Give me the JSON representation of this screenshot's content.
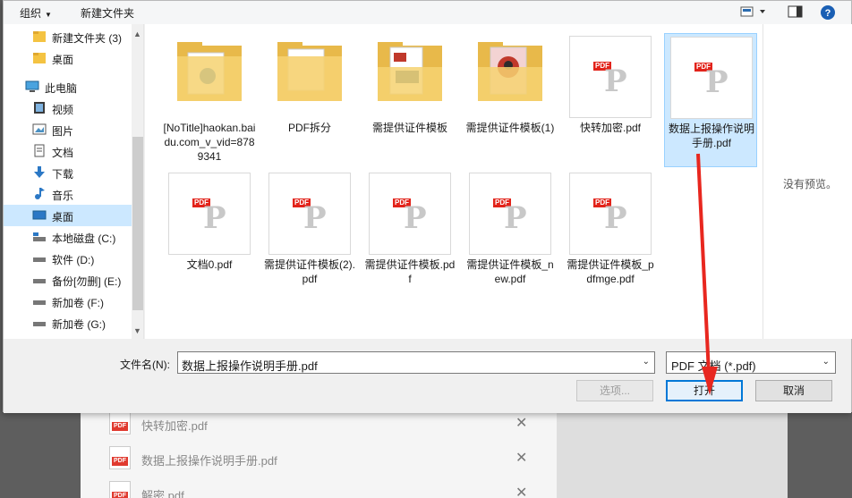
{
  "toolbar": {
    "organize_label": "组织",
    "new_folder_label": "新建文件夹"
  },
  "nav": {
    "items": [
      {
        "label": "新建文件夹 (3)",
        "icon": "folder-icon"
      },
      {
        "label": "桌面",
        "icon": "folder-icon"
      },
      {
        "label": "此电脑",
        "icon": "computer-icon"
      },
      {
        "label": "视频",
        "icon": "video-icon"
      },
      {
        "label": "图片",
        "icon": "picture-icon"
      },
      {
        "label": "文档",
        "icon": "document-icon"
      },
      {
        "label": "下载",
        "icon": "download-icon"
      },
      {
        "label": "音乐",
        "icon": "music-icon"
      },
      {
        "label": "桌面",
        "icon": "desktop-icon"
      },
      {
        "label": "本地磁盘 (C:)",
        "icon": "drive-icon"
      },
      {
        "label": "软件 (D:)",
        "icon": "drive-icon"
      },
      {
        "label": "备份[勿删] (E:)",
        "icon": "drive-icon"
      },
      {
        "label": "新加卷 (F:)",
        "icon": "drive-icon"
      },
      {
        "label": "新加卷 (G:)",
        "icon": "drive-icon"
      }
    ]
  },
  "files": [
    {
      "name": "[NoTitle]haokan.baidu.com_v_vid=8789341",
      "type": "folder"
    },
    {
      "name": "PDF拆分",
      "type": "folder"
    },
    {
      "name": "需提供证件模板",
      "type": "folder"
    },
    {
      "name": "需提供证件模板(1)",
      "type": "folder"
    },
    {
      "name": "快转加密.pdf",
      "type": "pdf"
    },
    {
      "name": "数据上报操作说明手册.pdf",
      "type": "pdf",
      "selected": true
    },
    {
      "name": "文档0.pdf",
      "type": "pdf"
    },
    {
      "name": "需提供证件模板(2).pdf",
      "type": "pdf"
    },
    {
      "name": "需提供证件模板.pdf",
      "type": "pdf"
    },
    {
      "name": "需提供证件模板_new.pdf",
      "type": "pdf"
    },
    {
      "name": "需提供证件模板_pdfmge.pdf",
      "type": "pdf"
    }
  ],
  "pdf_tag": "PDF",
  "preview": {
    "message": "没有预览。"
  },
  "bottom": {
    "filename_label": "文件名(N):",
    "filename_value": "数据上报操作说明手册.pdf",
    "filetype_value": "PDF 文档 (*.pdf)",
    "options_label": "选项...",
    "open_label": "打开",
    "cancel_label": "取消"
  },
  "background": {
    "rows": [
      {
        "name": "快转加密.pdf"
      },
      {
        "name": "数据上报操作说明手册.pdf"
      },
      {
        "name": "解密.pdf"
      }
    ],
    "close_symbol": "✕"
  },
  "colors": {
    "selection": "#cce8ff",
    "accent": "#0078d7",
    "pdf_red": "#e2231a",
    "annotation_arrow": "#e8271f"
  }
}
